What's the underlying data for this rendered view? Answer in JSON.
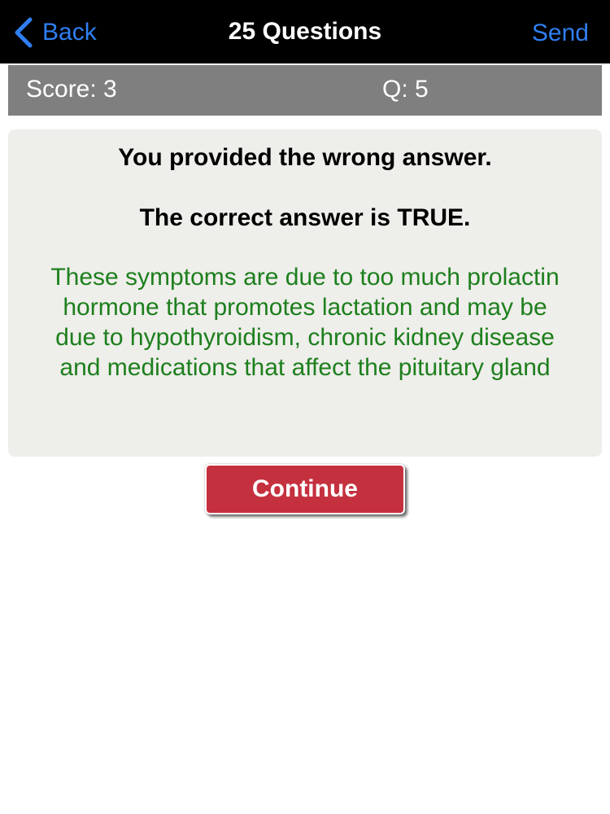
{
  "navbar": {
    "back_label": "Back",
    "back_icon": "chevron-left-icon",
    "title": "25 Questions",
    "send_label": "Send"
  },
  "status": {
    "score": "Score: 3",
    "question": "Q: 5"
  },
  "feedback": {
    "wrong_message": "You provided the wrong answer.",
    "correct_message": "The correct answer is TRUE.",
    "explanation": "These symptoms are due to too much prolactin hormone that promotes lactation and may be due to hypothyroidism, chronic kidney disease and medications that affect the pituitary gland"
  },
  "actions": {
    "continue_label": "Continue"
  },
  "colors": {
    "navbar_bg": "#000000",
    "link_blue": "#2f7ff2",
    "scorebar_bg": "#7f7f7f",
    "card_bg": "#eeeeea",
    "explanation_green": "#1d7f1d",
    "continue_red": "#c5303f"
  }
}
